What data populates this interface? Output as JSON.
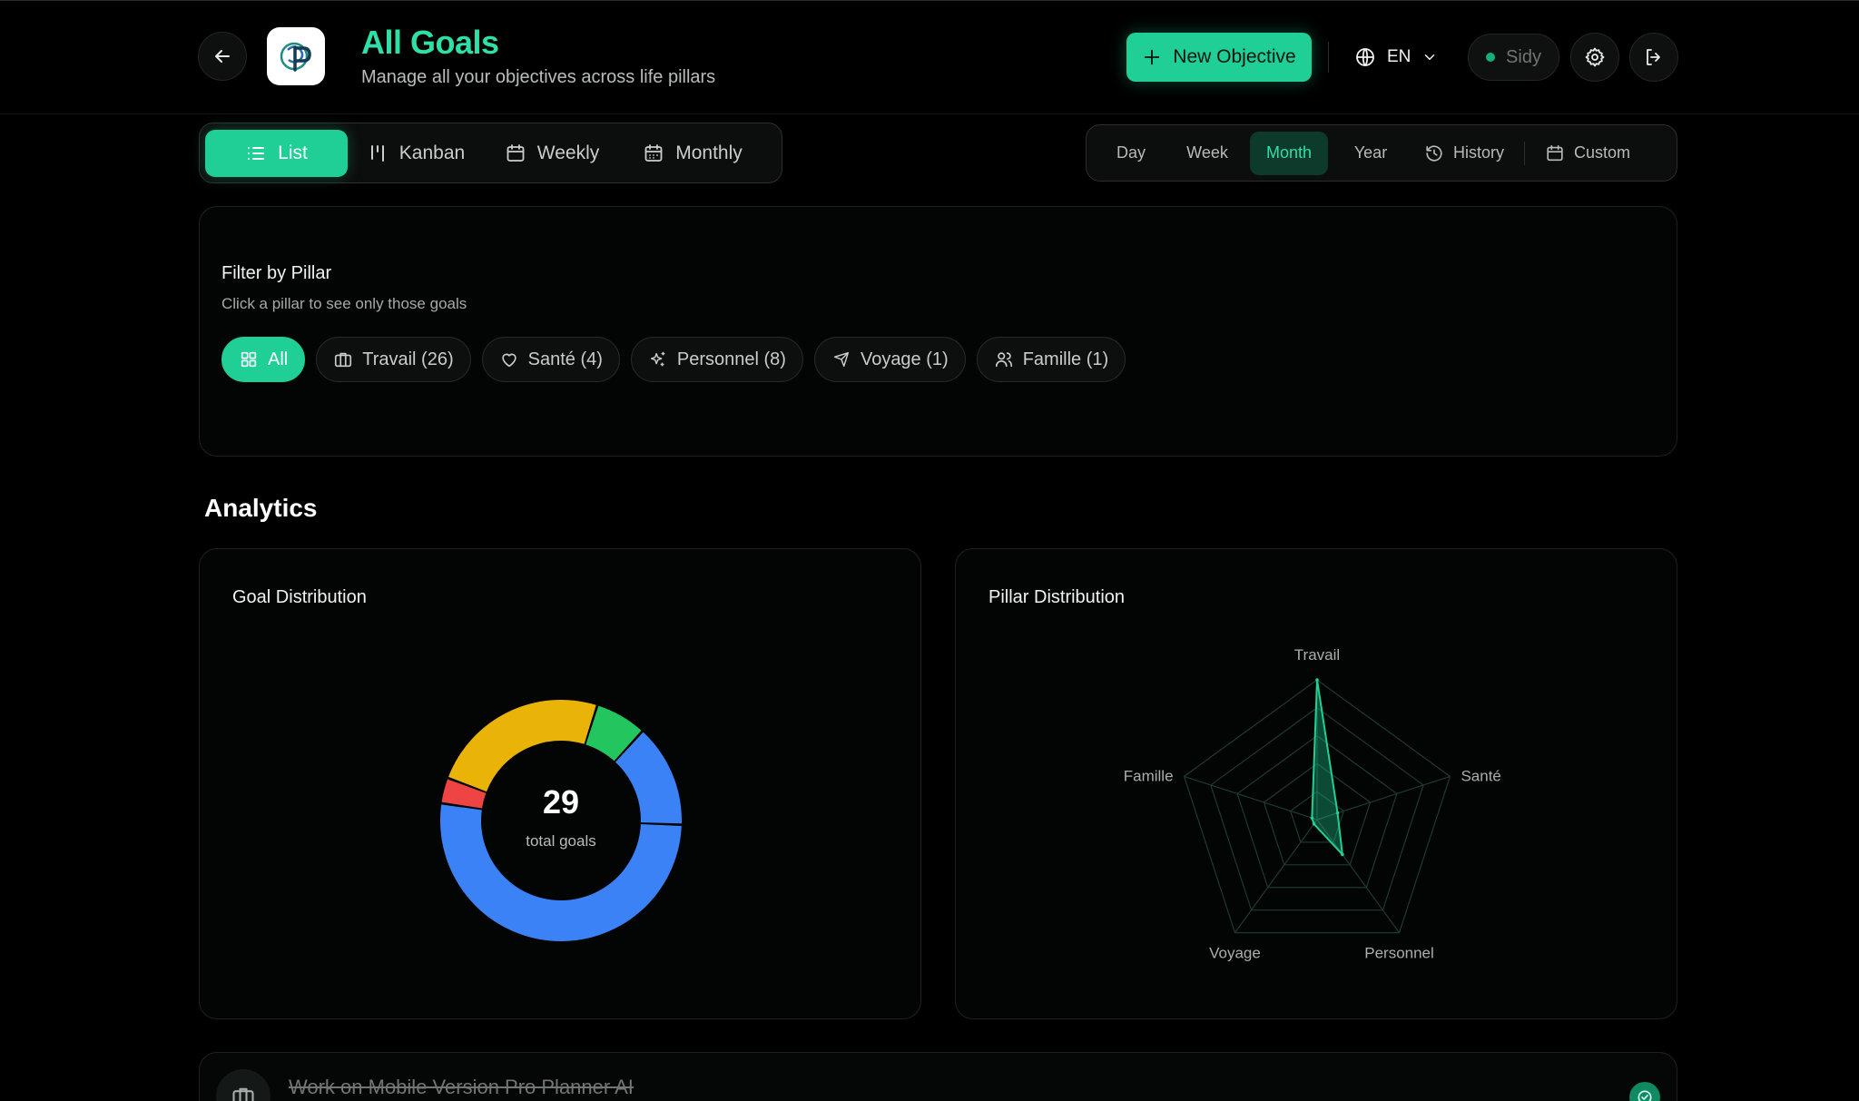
{
  "header": {
    "title": "All Goals",
    "subtitle": "Manage all your objectives across life pillars",
    "new_objective_label": "New Objective",
    "language": "EN",
    "user_name": "Sidy"
  },
  "views": {
    "tabs": [
      {
        "label": "List",
        "icon": "list-icon",
        "active": true
      },
      {
        "label": "Kanban",
        "icon": "kanban-icon",
        "active": false
      },
      {
        "label": "Weekly",
        "icon": "calendar-icon",
        "active": false
      },
      {
        "label": "Monthly",
        "icon": "calendar-grid-icon",
        "active": false
      }
    ]
  },
  "periods": {
    "tabs": [
      {
        "label": "Day",
        "active": false
      },
      {
        "label": "Week",
        "active": false
      },
      {
        "label": "Month",
        "active": true
      },
      {
        "label": "Year",
        "active": false
      },
      {
        "label": "History",
        "icon": "history-icon",
        "active": false
      },
      {
        "label": "Custom",
        "icon": "calendar-icon",
        "active": false
      }
    ]
  },
  "filter": {
    "title": "Filter by Pillar",
    "subtitle": "Click a pillar to see only those goals",
    "pills": [
      {
        "label": "All",
        "icon": "grid-icon",
        "active": true
      },
      {
        "label": "Travail (26)",
        "icon": "briefcase-icon",
        "active": false
      },
      {
        "label": "Santé (4)",
        "icon": "heart-icon",
        "active": false
      },
      {
        "label": "Personnel (8)",
        "icon": "sparkles-icon",
        "active": false
      },
      {
        "label": "Voyage (1)",
        "icon": "plane-icon",
        "active": false
      },
      {
        "label": "Famille (1)",
        "icon": "users-icon",
        "active": false
      }
    ]
  },
  "analytics": {
    "title": "Analytics",
    "goal_distribution_title": "Goal Distribution",
    "pillar_distribution_title": "Pillar Distribution"
  },
  "chart_data": [
    {
      "type": "pie",
      "title": "Goal Distribution",
      "center_value": "29",
      "center_label": "total goals",
      "values": [
        15,
        1,
        7,
        2,
        4
      ],
      "colors": [
        "#3b82f6",
        "#ef4444",
        "#eab308",
        "#22c55e",
        "#3b82f6"
      ]
    },
    {
      "type": "radar",
      "title": "Pillar Distribution",
      "categories": [
        "Travail",
        "Santé",
        "Personnel",
        "Voyage",
        "Famille"
      ],
      "values": [
        26,
        4,
        8,
        1,
        1
      ],
      "max": 26,
      "color": "#1fcf96"
    }
  ],
  "goals": [
    {
      "title": "Work on Mobile Version Pro Planner AI",
      "icon": "briefcase-icon",
      "completed": true
    }
  ],
  "colors": {
    "accent": "#1fcf96",
    "title_accent": "#2ee0a8",
    "background": "#000000"
  }
}
